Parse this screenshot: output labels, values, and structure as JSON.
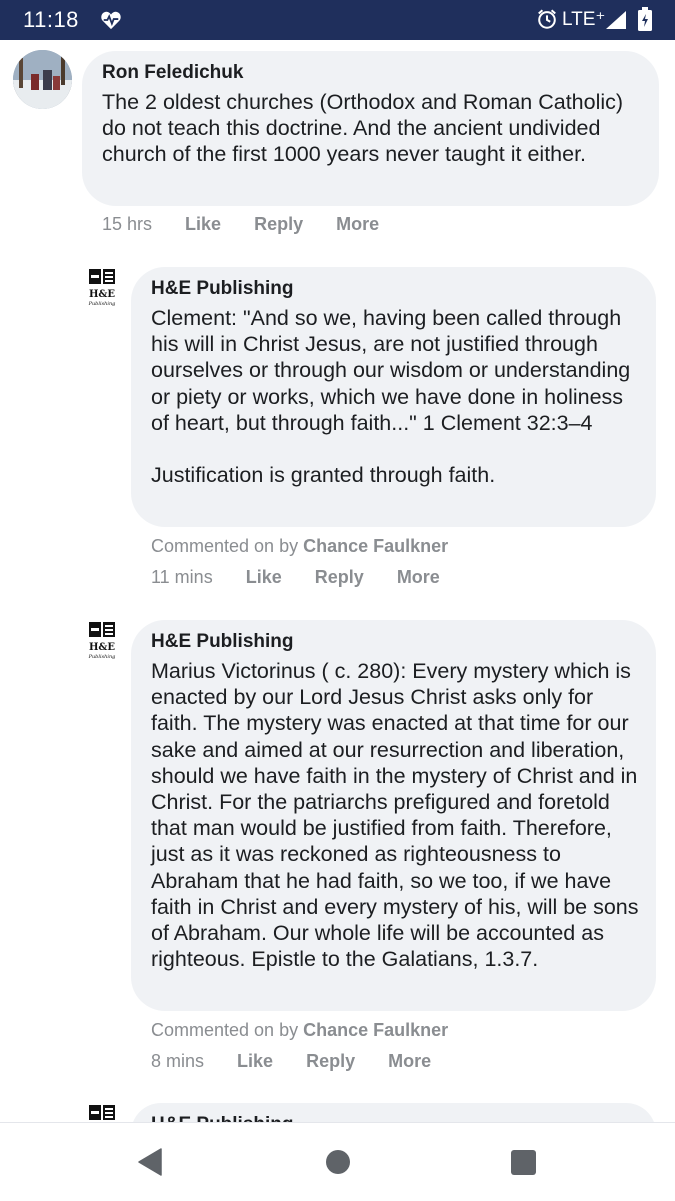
{
  "status_bar": {
    "time": "11:18",
    "network": "LTE⁺",
    "icons": [
      "heart-monitor-icon",
      "alarm-icon",
      "signal-icon",
      "battery-icon"
    ]
  },
  "comments": [
    {
      "author": "Ron Feledichuk",
      "avatar": "user-photo",
      "text": [
        "The 2 oldest churches (Orthodox and Roman Catholic) do not teach this doctrine. And the ancient undivided church of the first 1000 years never taught it either."
      ],
      "time": "15 hrs",
      "actions": [
        "Like",
        "Reply",
        "More"
      ]
    },
    {
      "author": "H&E Publishing",
      "avatar": "he-publishing-logo",
      "text": [
        "Clement: \"And so we, having been called through his will in Christ Jesus, are not justified through ourselves or through our wisdom or understanding or piety or works, which we have done in holiness of heart, but through faith...\" 1 Clement 32:3–4",
        "Justification is granted through faith."
      ],
      "commented_on_by_label": "Commented on by",
      "commented_on_by_name": "Chance Faulkner",
      "time": "11 mins",
      "actions": [
        "Like",
        "Reply",
        "More"
      ]
    },
    {
      "author": "H&E Publishing",
      "avatar": "he-publishing-logo",
      "text": [
        "Marius Victorinus ( c. 280): Every mystery which is enacted by our Lord Jesus Christ asks only for faith. The mystery was enacted at that time for our sake and aimed at our resurrection and liberation, should we have faith in the mystery of Christ and in Christ. For the patriarchs prefigured and foretold that man would be justified from faith. Therefore, just as it was reckoned as righteousness to Abraham that he had faith, so we too, if we have faith in Christ and every mystery of his, will be sons of Abraham. Our whole life will be accounted as righteous. Epistle to the Galatians, 1.3.7."
      ],
      "commented_on_by_label": "Commented on by",
      "commented_on_by_name": "Chance Faulkner",
      "time": "8 mins",
      "actions": [
        "Like",
        "Reply",
        "More"
      ]
    },
    {
      "author": "H&E Publishing",
      "avatar": "he-publishing-logo"
    }
  ],
  "logo_text": {
    "initials": "H&E",
    "script": "Publishing"
  },
  "nav_bar": {
    "buttons": [
      "back-icon",
      "home-icon",
      "recents-icon"
    ]
  },
  "colors": {
    "status_bar": "#1f2f5c",
    "bubble": "#f0f2f5",
    "meta_text": "#8a8d91",
    "body_text": "#1c1e21"
  }
}
